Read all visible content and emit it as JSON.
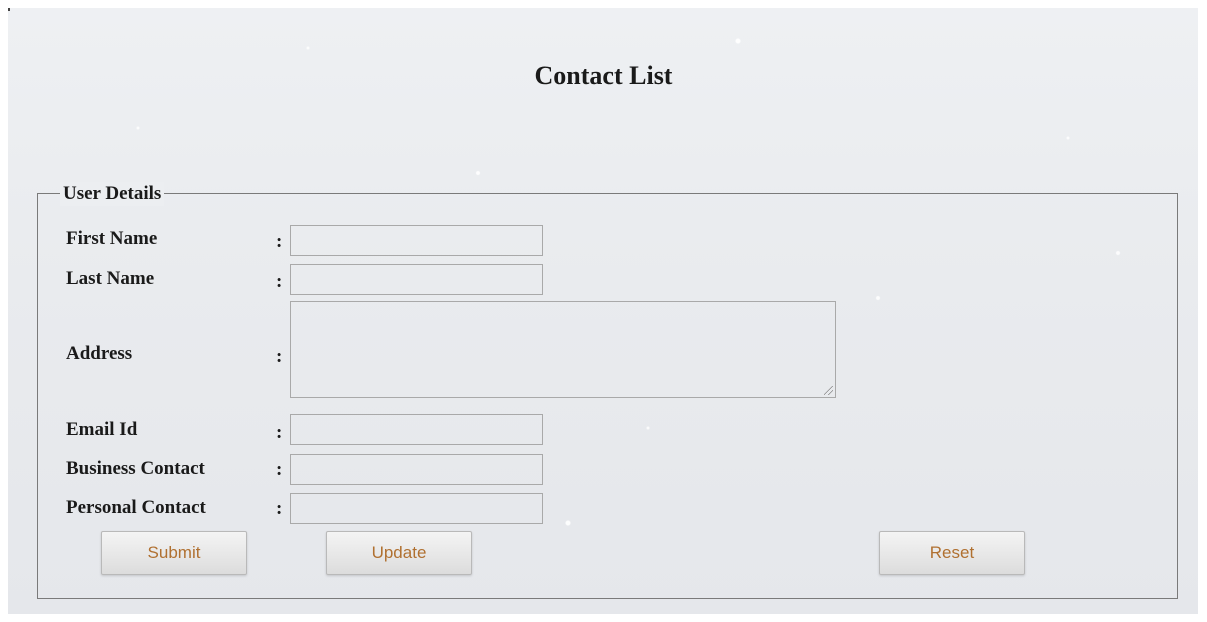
{
  "page": {
    "title": "Contact List"
  },
  "form": {
    "legend": "User Details",
    "separator": ":",
    "fields": [
      {
        "label": "First Name",
        "value": "",
        "type": "text"
      },
      {
        "label": "Last Name",
        "value": "",
        "type": "text"
      },
      {
        "label": "Address",
        "value": "",
        "type": "textarea"
      },
      {
        "label": "Email Id",
        "value": "",
        "type": "text"
      },
      {
        "label": "Business Contact",
        "value": "",
        "type": "text"
      },
      {
        "label": "Personal Contact",
        "value": "",
        "type": "text"
      }
    ],
    "buttons": {
      "submit": "Submit",
      "update": "Update",
      "reset": "Reset"
    }
  },
  "colors": {
    "button_text": "#b07030",
    "text": "#1a1a1a",
    "border": "#7a7a7a"
  }
}
